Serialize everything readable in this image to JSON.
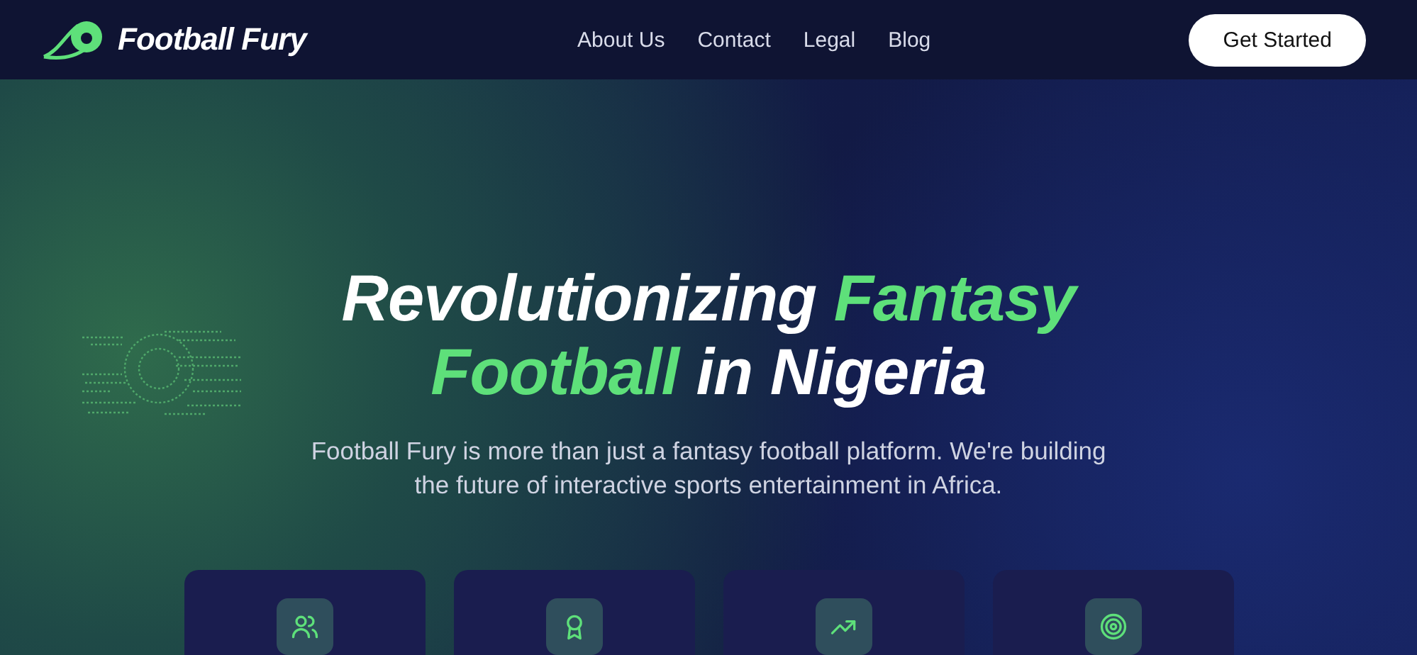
{
  "brand": {
    "name": "Football Fury"
  },
  "nav": [
    "About Us",
    "Contact",
    "Legal",
    "Blog"
  ],
  "cta": {
    "label": "Get Started"
  },
  "hero": {
    "headline_lines": [
      [
        {
          "text": "Revolutionizing ",
          "highlight": false
        },
        {
          "text": "Fantasy",
          "highlight": true
        }
      ],
      [
        {
          "text": "Football",
          "highlight": true
        },
        {
          "text": " in Nigeria",
          "highlight": false
        }
      ]
    ],
    "description": "Football Fury is more than just a fantasy football platform. We're building the future of interactive sports entertainment in Africa."
  },
  "features": [
    {
      "kind": "people"
    },
    {
      "kind": "award"
    },
    {
      "kind": "trend"
    },
    {
      "kind": "target"
    }
  ]
}
